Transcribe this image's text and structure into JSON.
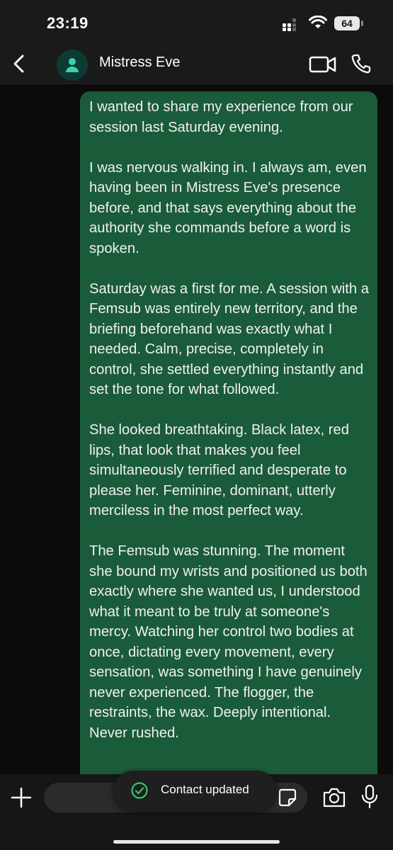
{
  "status_bar": {
    "time": "23:19",
    "battery": "64"
  },
  "header": {
    "contact_name": "Mistress Eve"
  },
  "message": {
    "paragraphs": [
      "I wanted to share my experience from our session last Saturday evening.",
      "I was nervous walking in. I always am, even having been in Mistress Eve's presence before, and that says everything about the authority she commands before a word is spoken.",
      "Saturday was a first for me. A session with a Femsub was entirely new territory, and the briefing beforehand was exactly what I needed. Calm, precise, completely in control, she settled everything instantly and set the tone for what followed.",
      "She looked breathtaking. Black latex, red lips, that look that makes you feel simultaneously terrified and desperate to please her. Feminine, dominant, utterly merciless in the most perfect way.",
      "The Femsub was stunning. The moment she bound my wrists and positioned us both exactly where she wanted us, I understood what it meant to be truly at someone's mercy. Watching her control two bodies at once, dictating every movement, every sensation, was something I have genuinely never experienced. The flogger, the restraints, the wax. Deeply intentional. Never rushed."
    ]
  },
  "toast": {
    "text": "Contact updated"
  },
  "colors": {
    "bubble": "#1a5b3a",
    "background": "#0b0b0b",
    "avatar_icon": "#3ad1b0",
    "toast_check": "#37c26b"
  },
  "icons": [
    "back-chevron-icon",
    "person-icon",
    "video-camera-icon",
    "phone-icon",
    "chevron-down-icon",
    "plus-icon",
    "sticker-icon",
    "camera-icon",
    "microphone-icon",
    "check-circle-icon"
  ]
}
